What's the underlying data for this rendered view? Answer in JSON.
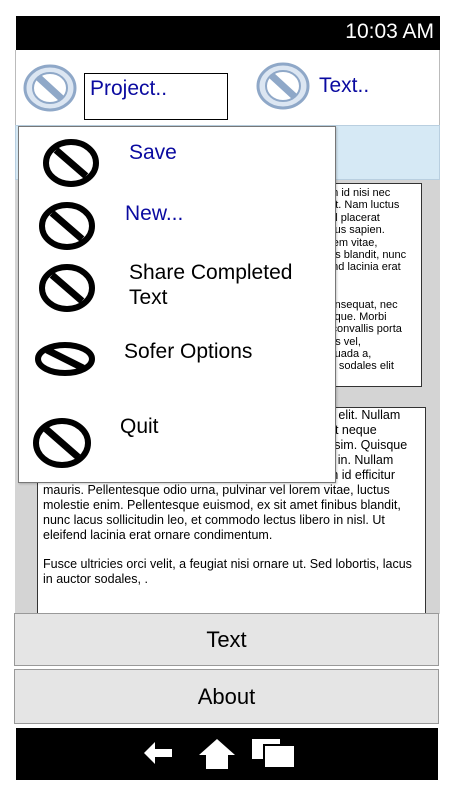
{
  "status_bar": {
    "time": "10:03 AM"
  },
  "app_bar": {
    "tabs": [
      {
        "label": "Project..",
        "icon": "disabled-icon"
      },
      {
        "label": "Text..",
        "icon": "disabled-icon"
      }
    ]
  },
  "menu": {
    "items": [
      {
        "label": "Save",
        "icon": "no-entry-icon"
      },
      {
        "label": "New...",
        "icon": "no-entry-icon"
      },
      {
        "label": "Share Completed Text",
        "icon": "no-entry-icon"
      },
      {
        "label": "Sofer Options",
        "icon": "no-entry-icon"
      },
      {
        "label": "Quit",
        "icon": "no-entry-icon"
      }
    ]
  },
  "content": {
    "box1_lines": [
      "am id nisi nec",
      "uet. Nam luctus",
      ", id placerat",
      "risus sapien.",
      "orem vitae,",
      "ous blandit, nunc",
      "fend lacinia erat",
      "",
      "",
      " consequat, nec",
      "esque. Morbi",
      "s convallis porta",
      "nus vel,",
      "esuada a,",
      "llis sodales elit"
    ],
    "box2_hidden_lines": [
      "g elit. Nullam",
      "at neque",
      "ssim. Quisque",
      "s in. Nullam"
    ],
    "box2_paragraph1": "commodo auctor auctor. Mauris ac risus sapien. Nam id efficitur mauris. Pellentesque odio urna, pulvinar vel lorem vitae, luctus molestie enim. Pellentesque euismod, ex sit amet finibus blandit, nunc lacus sollicitudin leo, et commodo lectus libero in nisl. Ut eleifend lacinia erat ornare condimentum.",
    "box2_paragraph2": "Fusce ultricies orci velit, a feugiat nisi ornare ut. Sed lobortis, lacus in auctor sodales, ."
  },
  "buttons": {
    "text_label": "Text",
    "about_label": "About"
  },
  "nav_bar": {
    "back_icon": "back-arrow-icon",
    "home_icon": "home-icon",
    "recents_icon": "recent-apps-icon"
  },
  "colors": {
    "link_blue": "#0a0aa0",
    "strip_blue": "#d6e9f5",
    "icon_fill": "#dce6f2",
    "icon_stroke": "#8fa8c8"
  }
}
